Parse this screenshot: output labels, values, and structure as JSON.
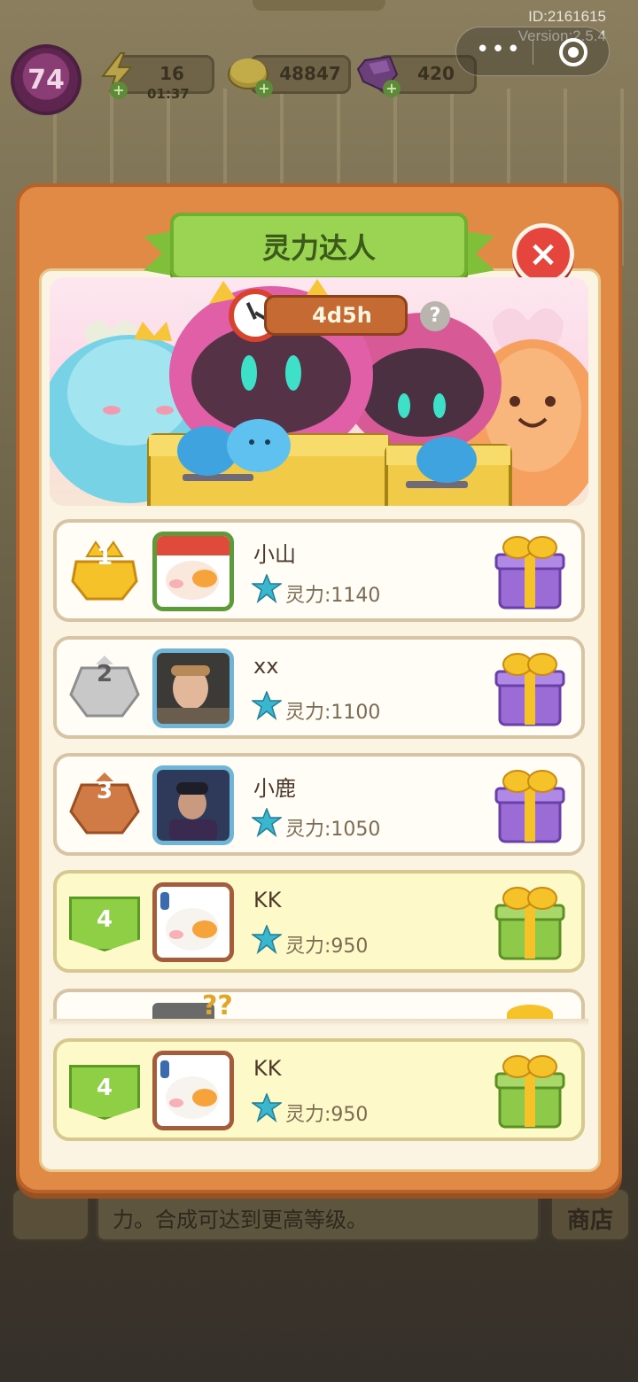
{
  "status": {
    "id_line": "ID:2161615",
    "version_line": "Version:2.5.4"
  },
  "hud": {
    "level": "74",
    "energy": "16",
    "energy_timer": "01:37",
    "coins": "48847",
    "gems": "420"
  },
  "background": {
    "hint_text": "力。合成可达到更高等级。",
    "shop_label": "商店"
  },
  "dialog": {
    "title": "灵力达人",
    "countdown": "4d5h",
    "help": "?",
    "close": "×"
  },
  "leaderboard": [
    {
      "rank": "1",
      "name": "小山",
      "power": "灵力:1140"
    },
    {
      "rank": "2",
      "name": "xx",
      "power": "灵力:1100"
    },
    {
      "rank": "3",
      "name": "小鹿",
      "power": "灵力:1050"
    },
    {
      "rank": "4",
      "name": "KK",
      "power": "灵力:950"
    }
  ],
  "self_row": {
    "rank": "4",
    "name": "KK",
    "power": "灵力:950"
  },
  "colors": {
    "dialog_frame": "#e08a45",
    "title_green": "#9bd452",
    "close_red": "#e5453c",
    "gold": "#f5c22a",
    "silver": "#c8c8c8",
    "bronze": "#d07a45"
  },
  "icons": {
    "energy": "lightning-icon",
    "coins": "coin-icon",
    "gems": "gem-icon",
    "timer": "clock-icon",
    "power": "star-icon",
    "reward": "gift-icon"
  }
}
